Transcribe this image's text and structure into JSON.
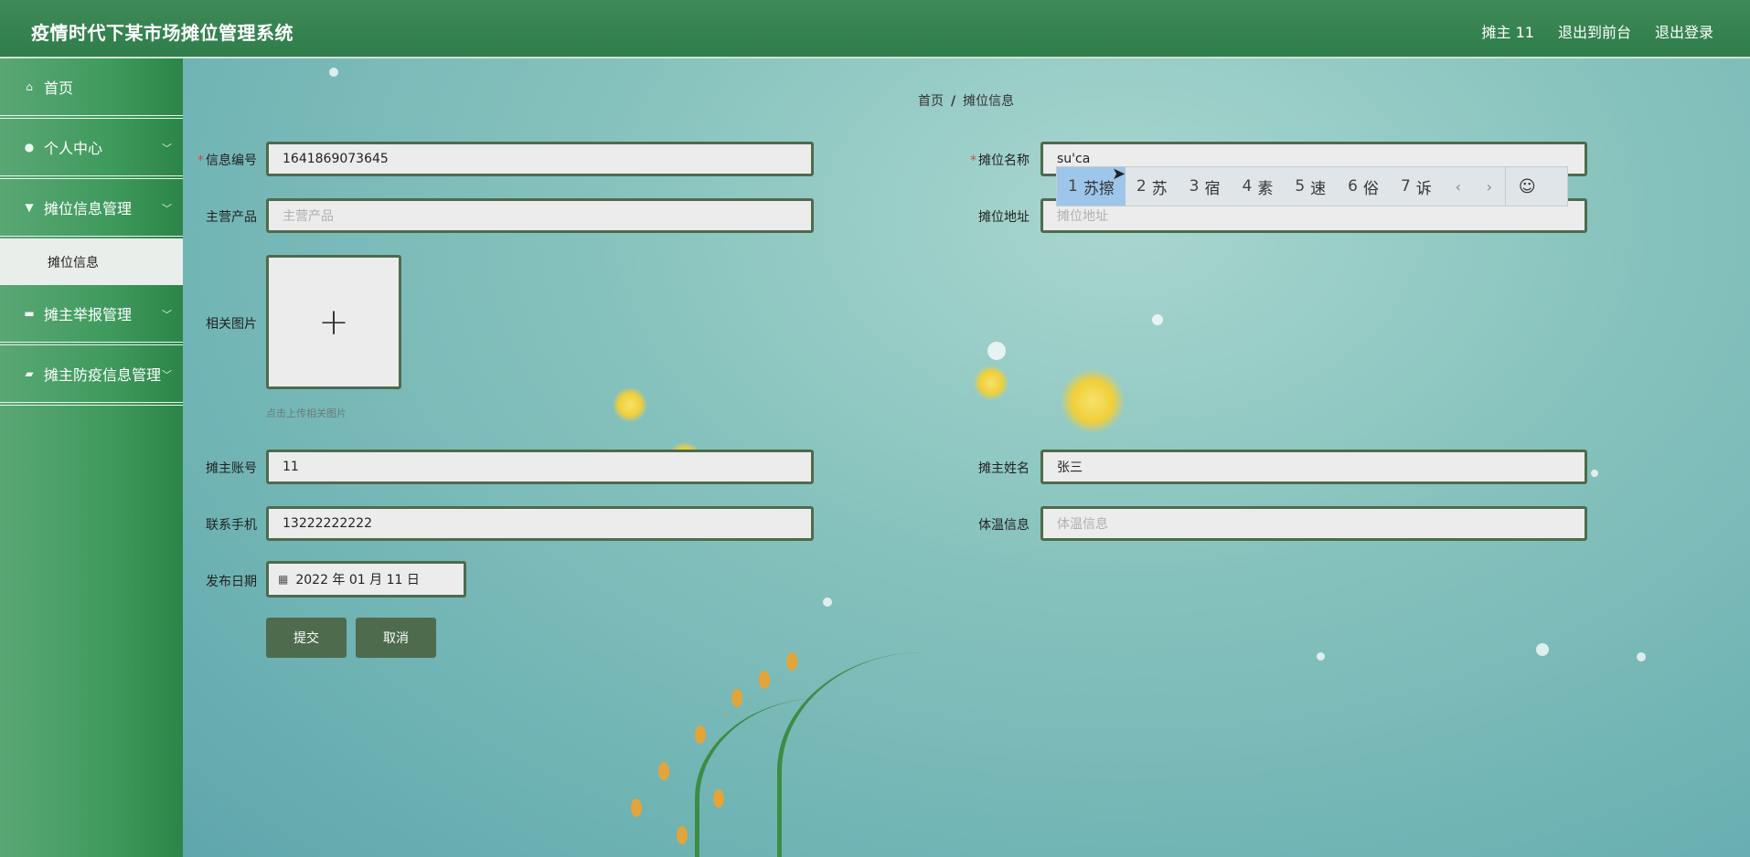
{
  "header": {
    "title": "疫情时代下某市场摊位管理系统",
    "user": "摊主 11",
    "back_to_front": "退出到前台",
    "logout": "退出登录"
  },
  "sidebar": {
    "items": [
      {
        "label": "首页",
        "icon": "home-icon"
      },
      {
        "label": "个人中心",
        "icon": "user-icon"
      },
      {
        "label": "摊位信息管理",
        "icon": "stall-icon"
      },
      {
        "label": "摊主举报管理",
        "icon": "report-icon"
      },
      {
        "label": "摊主防疫信息管理",
        "icon": "health-icon"
      }
    ],
    "submenu": {
      "label": "摊位信息"
    }
  },
  "breadcrumb": {
    "home": "首页",
    "sep": "/",
    "current": "摊位信息"
  },
  "form": {
    "info_no": {
      "label": "信息编号",
      "value": "1641869073645"
    },
    "stall_name": {
      "label": "摊位名称",
      "value": "su'ca"
    },
    "main_product": {
      "label": "主营产品",
      "placeholder": "主营产品"
    },
    "stall_address": {
      "label": "摊位地址",
      "placeholder": "摊位地址"
    },
    "images": {
      "label": "相关图片",
      "hint": "点击上传相关图片"
    },
    "owner_account": {
      "label": "摊主账号",
      "value": "11"
    },
    "owner_name": {
      "label": "摊主姓名",
      "value": "张三"
    },
    "phone": {
      "label": "联系手机",
      "value": "13222222222"
    },
    "temperature": {
      "label": "体温信息",
      "placeholder": "体温信息"
    },
    "publish_date": {
      "label": "发布日期",
      "value": "2022 年 01 月 11 日"
    },
    "submit": "提交",
    "cancel": "取消"
  },
  "ime": {
    "candidates": [
      {
        "n": "1",
        "text": "苏擦"
      },
      {
        "n": "2",
        "text": "苏"
      },
      {
        "n": "3",
        "text": "宿"
      },
      {
        "n": "4",
        "text": "素"
      },
      {
        "n": "5",
        "text": "速"
      },
      {
        "n": "6",
        "text": "俗"
      },
      {
        "n": "7",
        "text": "诉"
      }
    ],
    "prev": "‹",
    "next": "›",
    "emoji": "☺"
  }
}
